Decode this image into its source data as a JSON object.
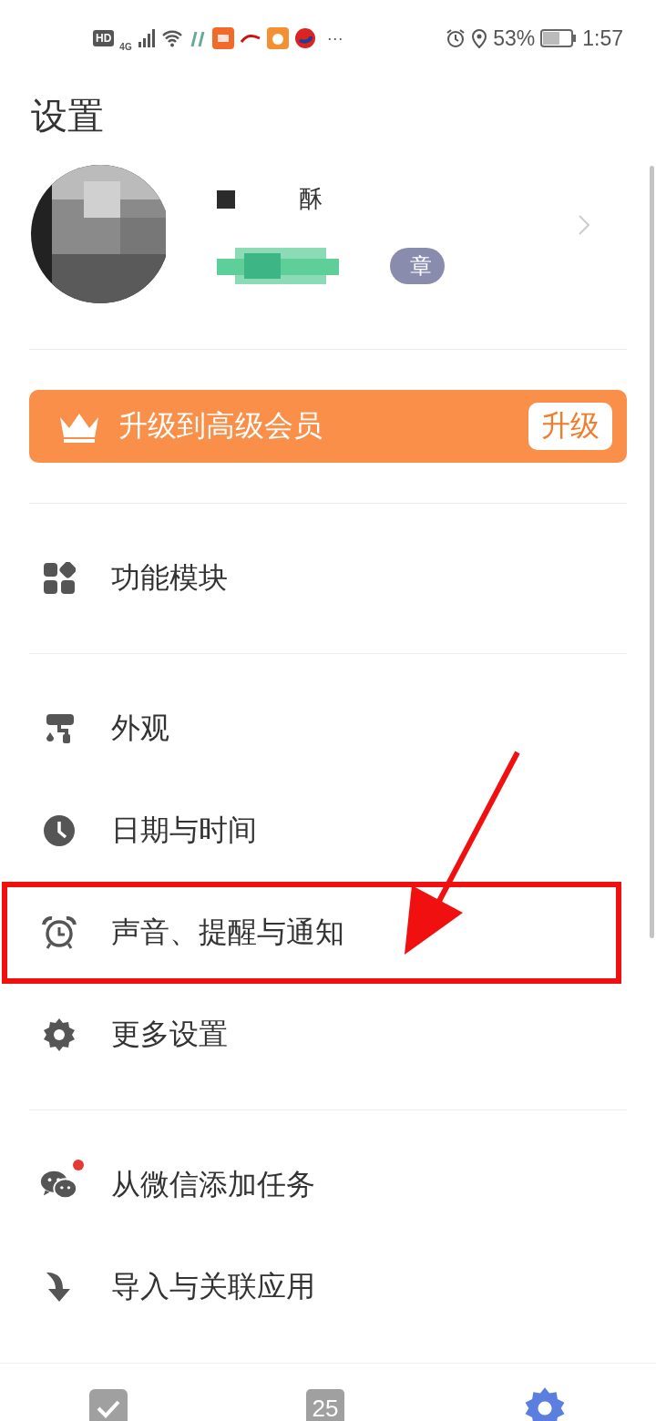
{
  "status_bar": {
    "network_badge": "HD",
    "network_type": "4G",
    "more": "···",
    "battery": "53%",
    "time": "1:57"
  },
  "title": "设置",
  "profile": {
    "name": "酥",
    "badge": "章"
  },
  "upgrade_banner": {
    "text": "升级到高级会员",
    "button": "升级"
  },
  "sections": [
    [
      {
        "kind": "modules",
        "label": "功能模块",
        "highlighted": false
      }
    ],
    [
      {
        "kind": "appearance",
        "label": "外观",
        "highlighted": false
      },
      {
        "kind": "clock",
        "label": "日期与时间",
        "highlighted": false
      },
      {
        "kind": "alarm",
        "label": "声音、提醒与通知",
        "highlighted": true
      },
      {
        "kind": "gear",
        "label": "更多设置",
        "highlighted": false
      }
    ],
    [
      {
        "kind": "wechat",
        "label": "从微信添加任务",
        "highlighted": false,
        "dot": true
      },
      {
        "kind": "import",
        "label": "导入与关联应用",
        "highlighted": false
      }
    ]
  ],
  "bottom_tabs": [
    {
      "kind": "tasks",
      "selected": false
    },
    {
      "kind": "calendar",
      "label": "25",
      "selected": false
    },
    {
      "kind": "settings",
      "selected": true
    }
  ],
  "annotation_arrow": true
}
